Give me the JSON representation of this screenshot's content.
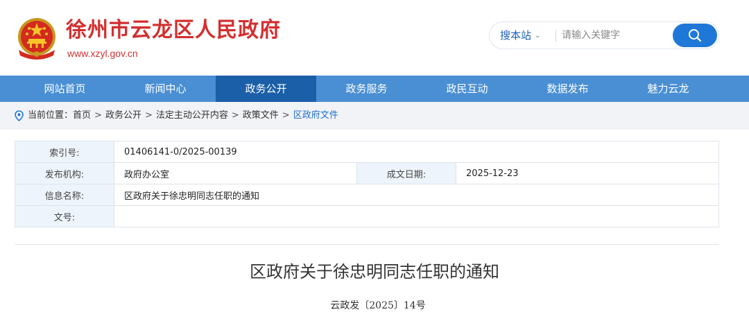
{
  "header": {
    "site_title": "徐州市云龙区人民政府",
    "site_url": "www.xzyl.gov.cn",
    "logo": "national-emblem-icon"
  },
  "search": {
    "scope_label": "搜本站",
    "placeholder": "请输入关键字",
    "button_icon": "search-icon"
  },
  "nav": {
    "items": [
      "网站首页",
      "新闻中心",
      "政务公开",
      "政务服务",
      "政民互动",
      "数据发布",
      "魅力云龙"
    ],
    "active_index": 2
  },
  "breadcrumb": {
    "prefix": "当前位置：",
    "items": [
      "首页",
      "政务公开",
      "法定主动公开内容",
      "政策文件",
      "区政府文件"
    ]
  },
  "info": {
    "index_label": "索引号:",
    "index_value": "01406141-0/2025-00139",
    "publisher_label": "发布机构:",
    "publisher_value": "政府办公室",
    "date_label": "成文日期:",
    "date_value": "2025-12-23",
    "name_label": "信息名称:",
    "name_value": "区政府关于徐忠明同志任职的通知",
    "docno_label": "文号:",
    "docno_value": ""
  },
  "document": {
    "title": "区政府关于徐忠明同志任职的通知",
    "number": "云政发〔2025〕14号"
  },
  "colors": {
    "brand_red": "#d32f2f",
    "nav_blue": "#4a8fd4",
    "nav_active": "#1b5fa8",
    "accent_blue": "#1f77d7"
  }
}
